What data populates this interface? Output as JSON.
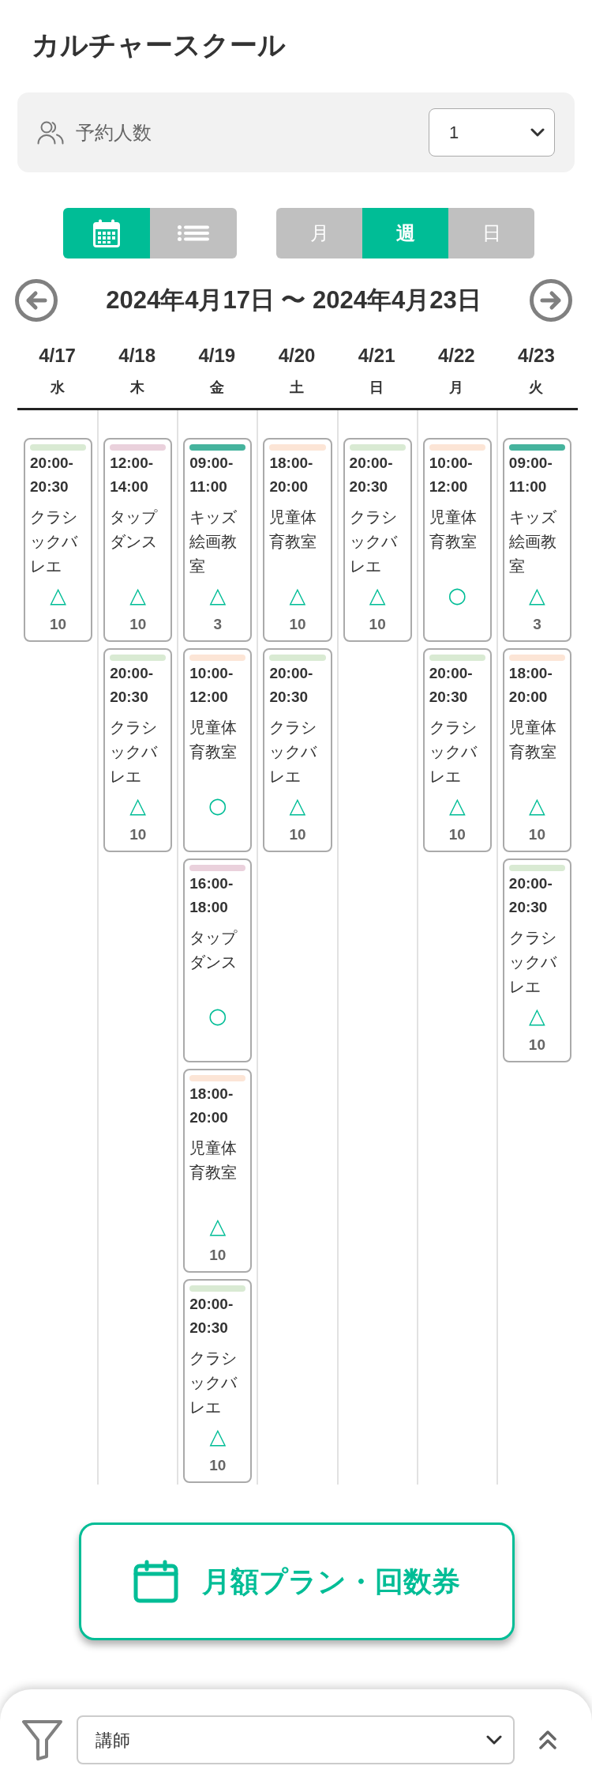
{
  "header": {
    "title": "カルチャースクール"
  },
  "party_size": {
    "label": "予約人数",
    "value": "1"
  },
  "view_modes": [
    {
      "kind": "calendar",
      "selected": true
    },
    {
      "kind": "list",
      "selected": false
    }
  ],
  "range_tabs": [
    {
      "label": "月",
      "selected": false
    },
    {
      "label": "週",
      "selected": true
    },
    {
      "label": "日",
      "selected": false
    }
  ],
  "date_nav": {
    "range": "2024年4月17日 〜 2024年4月23日"
  },
  "days": [
    {
      "date": "4/17",
      "weekday": "水",
      "lessons": [
        {
          "time": "20:00-20:30",
          "name": "クラシックバレエ",
          "color": "#d9ead3",
          "availability": "△",
          "count": "10"
        }
      ]
    },
    {
      "date": "4/18",
      "weekday": "木",
      "lessons": [
        {
          "time": "12:00-14:00",
          "name": "タップダンス",
          "color": "#ead1dc",
          "availability": "△",
          "count": "10"
        },
        {
          "time": "20:00-20:30",
          "name": "クラシックバレエ",
          "color": "#d9ead3",
          "availability": "△",
          "count": "10"
        }
      ]
    },
    {
      "date": "4/19",
      "weekday": "金",
      "lessons": [
        {
          "time": "09:00-11:00",
          "name": "キッズ絵画教室",
          "color": "#45b39d",
          "availability": "△",
          "count": "3"
        },
        {
          "time": "10:00-12:00",
          "name": "児童体育教室",
          "color": "#fce5d6",
          "availability": "○"
        },
        {
          "time": "16:00-18:00",
          "name": "タップダンス",
          "color": "#ead1dc",
          "availability": "○"
        },
        {
          "time": "18:00-20:00",
          "name": "児童体育教室",
          "color": "#fce5d6",
          "availability": "△",
          "count": "10"
        },
        {
          "time": "20:00-20:30",
          "name": "クラシックバレエ",
          "color": "#d9ead3",
          "availability": "△",
          "count": "10"
        }
      ]
    },
    {
      "date": "4/20",
      "weekday": "土",
      "lessons": [
        {
          "time": "18:00-20:00",
          "name": "児童体育教室",
          "color": "#fce5d6",
          "availability": "△",
          "count": "10"
        },
        {
          "time": "20:00-20:30",
          "name": "クラシックバレエ",
          "color": "#d9ead3",
          "availability": "△",
          "count": "10"
        }
      ]
    },
    {
      "date": "4/21",
      "weekday": "日",
      "lessons": [
        {
          "time": "20:00-20:30",
          "name": "クラシックバレエ",
          "color": "#d9ead3",
          "availability": "△",
          "count": "10"
        }
      ]
    },
    {
      "date": "4/22",
      "weekday": "月",
      "lessons": [
        {
          "time": "10:00-12:00",
          "name": "児童体育教室",
          "color": "#fce5d6",
          "availability": "○"
        },
        {
          "time": "20:00-20:30",
          "name": "クラシックバレエ",
          "color": "#d9ead3",
          "availability": "△",
          "count": "10"
        }
      ]
    },
    {
      "date": "4/23",
      "weekday": "火",
      "lessons": [
        {
          "time": "09:00-11:00",
          "name": "キッズ絵画教室",
          "color": "#45b39d",
          "availability": "△",
          "count": "3"
        },
        {
          "time": "18:00-20:00",
          "name": "児童体育教室",
          "color": "#fce5d6",
          "availability": "△",
          "count": "10"
        },
        {
          "time": "20:00-20:30",
          "name": "クラシックバレエ",
          "color": "#d9ead3",
          "availability": "△",
          "count": "10"
        }
      ]
    }
  ],
  "plan_button": {
    "label": "月額プラン・回数券"
  },
  "filter": {
    "value": "講師"
  }
}
